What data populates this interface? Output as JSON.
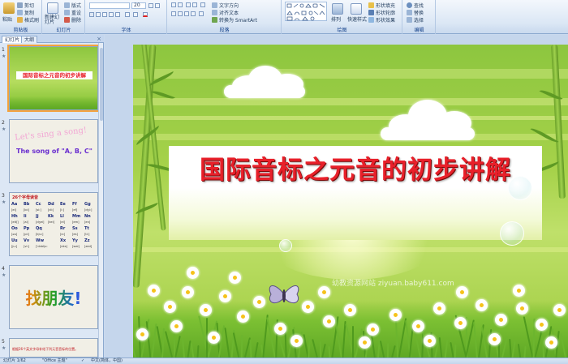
{
  "ribbon": {
    "clipboard": {
      "paste_label": "粘贴",
      "cut_label": "剪切",
      "copy_label": "复制",
      "format_painter_label": "格式刷",
      "group_label": "剪贴板"
    },
    "slides": {
      "new_slide_label": "新建幻灯片",
      "layout_label": "版式",
      "reset_label": "重设",
      "delete_label": "删除",
      "group_label": "幻灯片"
    },
    "font": {
      "font_size_value": "20",
      "group_label": "字体"
    },
    "paragraph": {
      "text_direction_label": "文字方向",
      "align_text_label": "对齐文本",
      "smartart_label": "转换为 SmartArt",
      "group_label": "段落"
    },
    "drawing": {
      "arrange_label": "排列",
      "quick_styles_label": "快速样式",
      "shape_fill_label": "形状填充",
      "shape_outline_label": "形状轮廓",
      "shape_effects_label": "形状效果",
      "group_label": "绘图"
    },
    "editing": {
      "find_label": "查找",
      "replace_label": "替换",
      "select_label": "选择",
      "group_label": "编辑"
    }
  },
  "left_pane": {
    "tabs": [
      {
        "label": "幻灯片"
      },
      {
        "label": "大纲"
      }
    ],
    "close_glyph": "×",
    "thumbnails": [
      {
        "number": "1",
        "title": "国际音标之元音的初步讲解"
      },
      {
        "number": "2",
        "line1": "Let's sing a song!",
        "line2": "The song of \"A, B, C\""
      },
      {
        "number": "3",
        "heading": "26个字母读音",
        "rows": [
          [
            "Aa",
            "Bb",
            "Cc",
            "Dd",
            "Ee",
            "Ff",
            "Gg"
          ],
          [
            "[ei]",
            "[bi:]",
            "[si:]",
            "[di:]",
            "[i:]",
            "[ef]",
            "[dʒi:]"
          ],
          [
            "Hh",
            "Ii",
            "Jj",
            "Kk",
            "Ll",
            "Mm",
            "Nn"
          ],
          [
            "[eitʃ]",
            "[ai]",
            "[dʒei]",
            "[kei]",
            "[el]",
            "[em]",
            "[en]"
          ],
          [
            "Oo",
            "Pp",
            "Qq",
            "",
            "Rr",
            "Ss",
            "Tt"
          ],
          [
            "[əu]",
            "[pi:]",
            "[kju:]",
            "",
            "[ɑ:]",
            "[es]",
            "[ti:]"
          ],
          [
            "Uu",
            "Vv",
            "Ww",
            "",
            "Xx",
            "Yy",
            "Zz"
          ],
          [
            "[ju:]",
            "[vi:]",
            "['dʌblju:]",
            "",
            "[eks]",
            "[wai]",
            "[zed]"
          ]
        ]
      },
      {
        "number": "4",
        "text": "找朋友!"
      },
      {
        "number": "5",
        "text": "根据26个英文字母补给下列元音音标的位置。"
      }
    ]
  },
  "slide": {
    "title": "国际音标之元音的初步讲解",
    "watermark": "幼教资源网站 ziyuan.baby611.com"
  },
  "status": {
    "slide_counter": "幻灯片 1/62",
    "theme": "\"Office 主题\"",
    "language": "中文(简体，中国)"
  }
}
